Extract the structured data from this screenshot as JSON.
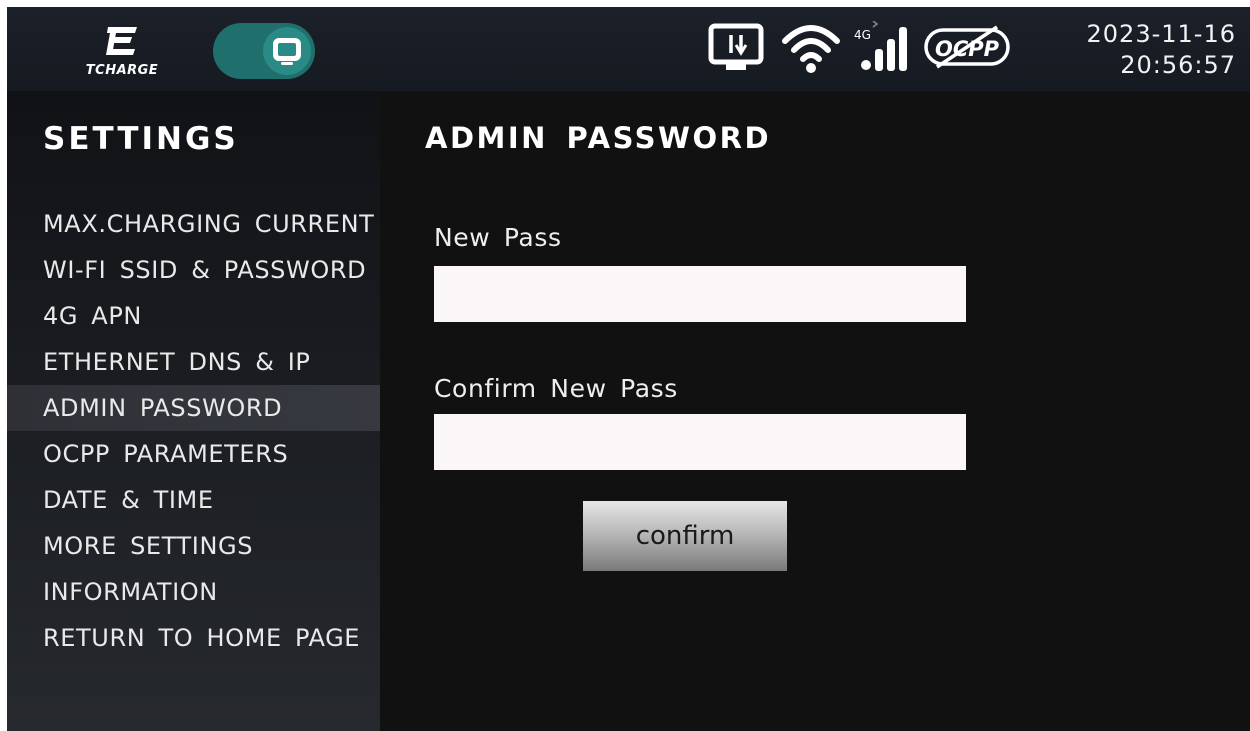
{
  "header": {
    "brand": "TCHARGE",
    "datetime": {
      "date": "2023-11-16",
      "time": "20:56:57"
    },
    "status_icons": [
      "ethernet-icon",
      "wifi-icon",
      "4g-signal-icon",
      "ocpp-disconnected-icon"
    ],
    "signal_label": "4G",
    "ocpp_label": "OCPP"
  },
  "sidebar": {
    "title": "SETTINGS",
    "items": [
      {
        "label": "MAX.CHARGING CURRENT"
      },
      {
        "label": "WI-FI SSID & PASSWORD"
      },
      {
        "label": "4G APN"
      },
      {
        "label": "ETHERNET DNS & IP"
      },
      {
        "label": "ADMIN PASSWORD"
      },
      {
        "label": "OCPP PARAMETERS"
      },
      {
        "label": "DATE & TIME"
      },
      {
        "label": "MORE SETTINGS"
      },
      {
        "label": "INFORMATION"
      },
      {
        "label": "RETURN TO HOME PAGE"
      }
    ],
    "active_index": 4
  },
  "main": {
    "title": "ADMIN PASSWORD",
    "new_pass": {
      "label": "New Pass",
      "value": ""
    },
    "confirm_pass": {
      "label": "Confirm New Pass",
      "value": ""
    },
    "confirm_button": "confirm"
  },
  "colors": {
    "accent_teal": "#1f6f6c",
    "background": "#111111",
    "input_bg": "#fbf6f8"
  }
}
